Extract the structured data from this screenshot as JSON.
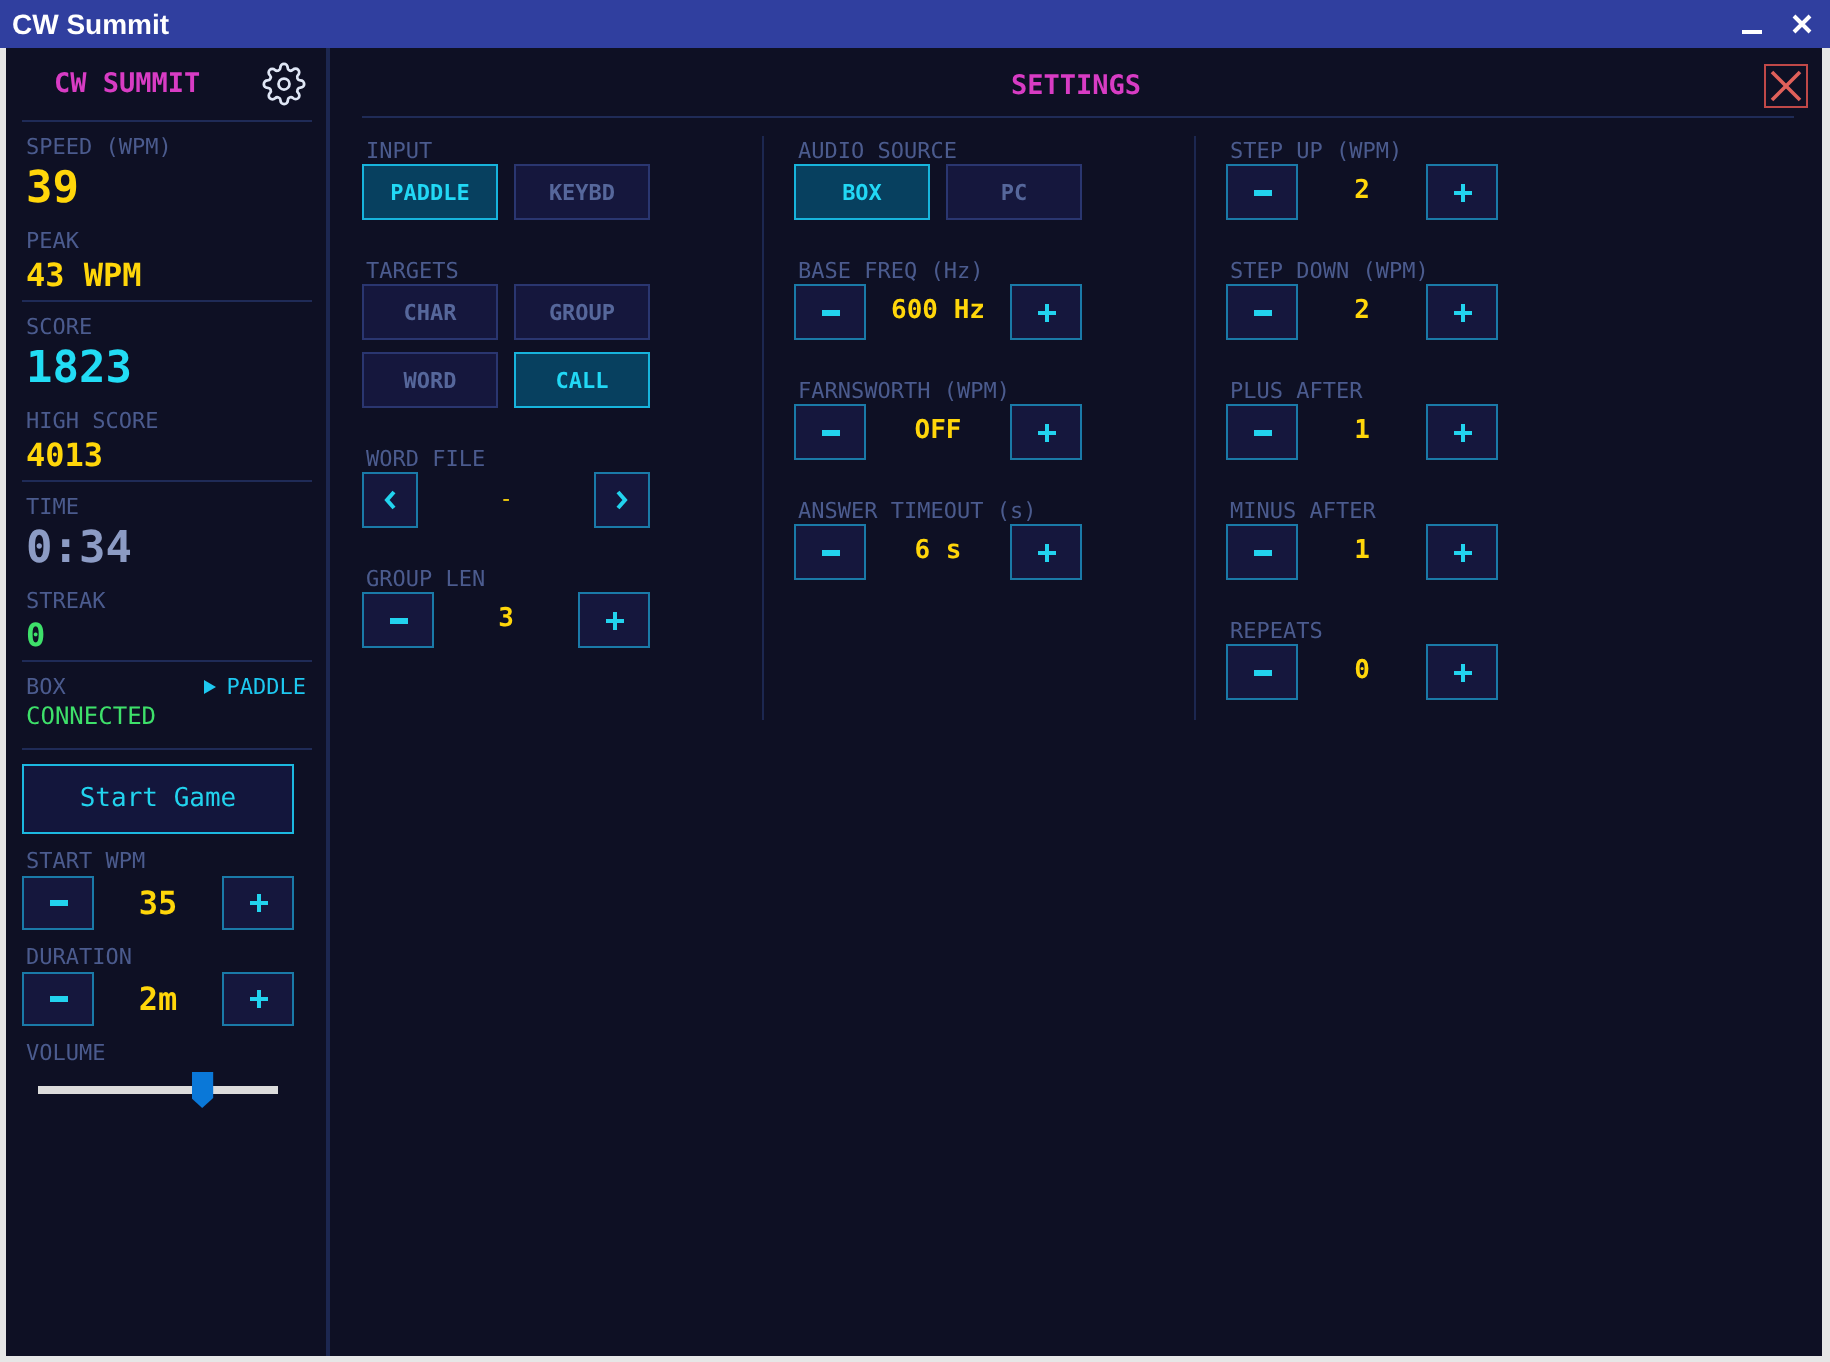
{
  "window": {
    "title": "CW Summit"
  },
  "sidebar": {
    "title": "CW SUMMIT",
    "sections": [
      {
        "stats": [
          {
            "label": "SPEED (WPM)",
            "value": "39",
            "kind": "major",
            "color": "#ffd60a"
          },
          {
            "label": "PEAK",
            "value": "43 WPM",
            "kind": "minor",
            "color": "#ffd60a"
          }
        ]
      },
      {
        "stats": [
          {
            "label": "SCORE",
            "value": "1823",
            "kind": "major",
            "color": "#22dcf5"
          },
          {
            "label": "HIGH SCORE",
            "value": "4013",
            "kind": "minor",
            "color": "#ffd60a"
          }
        ]
      },
      {
        "stats": [
          {
            "label": "TIME",
            "value": "0:34",
            "kind": "major",
            "color": "#8c9bc4"
          },
          {
            "label": "STREAK",
            "value": "0",
            "kind": "minor",
            "color": "#3ee06a"
          }
        ]
      }
    ],
    "box": {
      "label": "BOX",
      "input": "PADDLE",
      "status": "CONNECTED",
      "connected": true
    },
    "start_button": "Start Game",
    "steppers": [
      {
        "label": "START WPM",
        "value": "35"
      },
      {
        "label": "DURATION",
        "value": "2m"
      }
    ],
    "volume": {
      "label": "VOLUME",
      "level": 0.68
    }
  },
  "settings": {
    "title": "SETTINGS",
    "columns": [
      {
        "fields": [
          {
            "kind": "toggle",
            "label": "INPUT",
            "options": [
              {
                "label": "PADDLE",
                "selected": true
              },
              {
                "label": "KEYBD",
                "selected": false
              }
            ]
          },
          {
            "kind": "toggle",
            "label": "TARGETS",
            "options": [
              {
                "label": "CHAR",
                "selected": false
              },
              {
                "label": "GROUP",
                "selected": false
              },
              {
                "label": "WORD",
                "selected": false
              },
              {
                "label": "CALL",
                "selected": true
              }
            ]
          },
          {
            "kind": "picker",
            "label": "WORD FILE",
            "value": "-"
          },
          {
            "kind": "stepper",
            "label": "GROUP LEN",
            "value": "3"
          }
        ]
      },
      {
        "fields": [
          {
            "kind": "toggle",
            "label": "AUDIO SOURCE",
            "options": [
              {
                "label": "BOX",
                "selected": true
              },
              {
                "label": "PC",
                "selected": false
              }
            ]
          },
          {
            "kind": "stepper",
            "label": "BASE FREQ (Hz)",
            "value": "600 Hz"
          },
          {
            "kind": "stepper",
            "label": "FARNSWORTH (WPM)",
            "value": "OFF"
          },
          {
            "kind": "stepper",
            "label": "ANSWER TIMEOUT (s)",
            "value": "6 s"
          }
        ]
      },
      {
        "fields": [
          {
            "kind": "stepper",
            "label": "STEP UP (WPM)",
            "value": "2"
          },
          {
            "kind": "stepper",
            "label": "STEP DOWN (WPM)",
            "value": "2"
          },
          {
            "kind": "stepper",
            "label": "PLUS AFTER",
            "value": "1"
          },
          {
            "kind": "stepper",
            "label": "MINUS AFTER",
            "value": "1"
          },
          {
            "kind": "stepper",
            "label": "REPEATS",
            "value": "0"
          }
        ]
      }
    ]
  }
}
